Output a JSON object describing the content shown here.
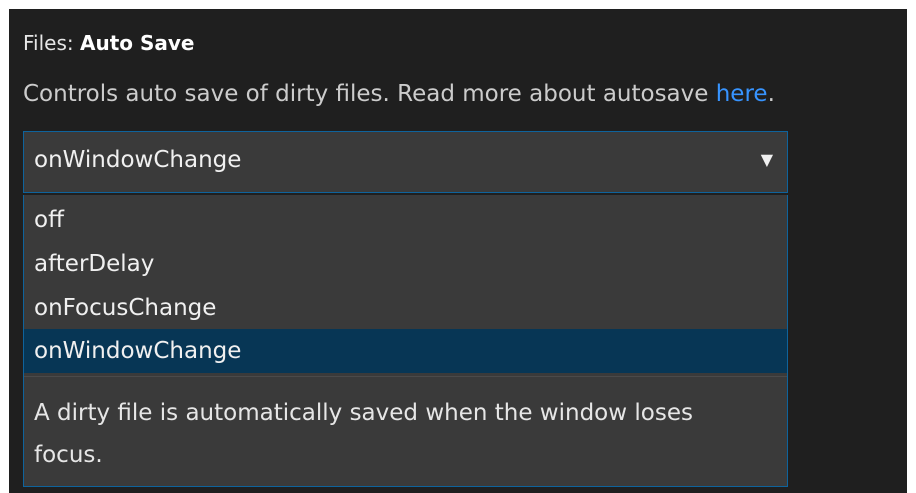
{
  "setting": {
    "category": "Files: ",
    "name": "Auto Save",
    "description": "Controls auto save of dirty files. Read more about autosave ",
    "link_text": "here",
    "period": "."
  },
  "select": {
    "value": "onWindowChange",
    "arrow": "▼",
    "options": [
      {
        "label": "off",
        "selected": false
      },
      {
        "label": "afterDelay",
        "selected": false
      },
      {
        "label": "onFocusChange",
        "selected": false
      },
      {
        "label": "onWindowChange",
        "selected": true
      }
    ],
    "option_description": "A dirty file is automatically saved when the window loses focus."
  },
  "colors": {
    "background": "#1f1f1f",
    "select_bg": "#3a3a3a",
    "border_accent": "#0e639c",
    "selected_option_bg": "#073655",
    "link": "#3794ff"
  }
}
